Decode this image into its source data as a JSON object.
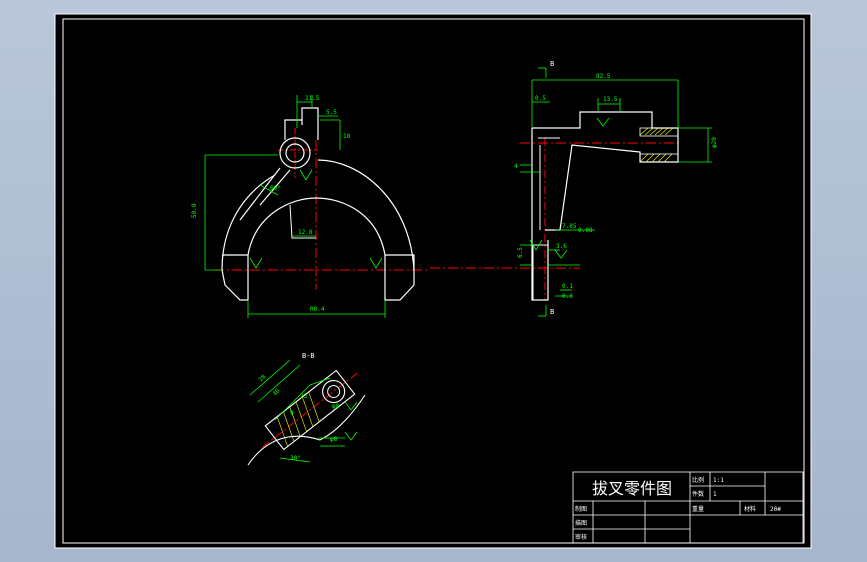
{
  "views": {
    "section_label_top": "B",
    "section_label_bottom": "B",
    "section_view_title": "B-B"
  },
  "dimensions": {
    "top_width_a": "11.5",
    "top_width_b": "5.5",
    "lug_height": "18",
    "fork_height": "50.8",
    "arm_angle": "60°",
    "slot_inner": "12.8",
    "fork_span": "R0.4",
    "side_overall": "82.5",
    "side_slot": "13.5",
    "side_offset": "0.5",
    "side_bore": "φ20",
    "side_ten": "10",
    "side_small": "4",
    "side_depth": "7.85",
    "side_depth2": "0.08",
    "tip_thk": "3.6",
    "tip_h": "6.5",
    "tip_t1": "0.1",
    "tip_t2": "0.3",
    "sec_a": "28",
    "sec_b": "46",
    "sec_c": "23",
    "sec_d": "9",
    "sec_angle": "30°",
    "sec_hole": "φ8",
    "sec_hole2": "φ8"
  },
  "title_block": {
    "title": "拔叉零件图",
    "scale_label": "比例",
    "scale_value": "1:1",
    "qty_label": "件数",
    "qty_value": "1",
    "drafter_label": "制图",
    "weight_label": "重量",
    "material_label": "材料",
    "material_value": "20#",
    "designer_label": "描图",
    "reviewer_label": "审核"
  },
  "colors": {
    "drawing_bg": "#000000",
    "outline": "#ffffff",
    "dimension": "#00ff00",
    "centerline": "#ff0000",
    "hatch": "#ffff00",
    "page_bg": "#aebdd1"
  }
}
